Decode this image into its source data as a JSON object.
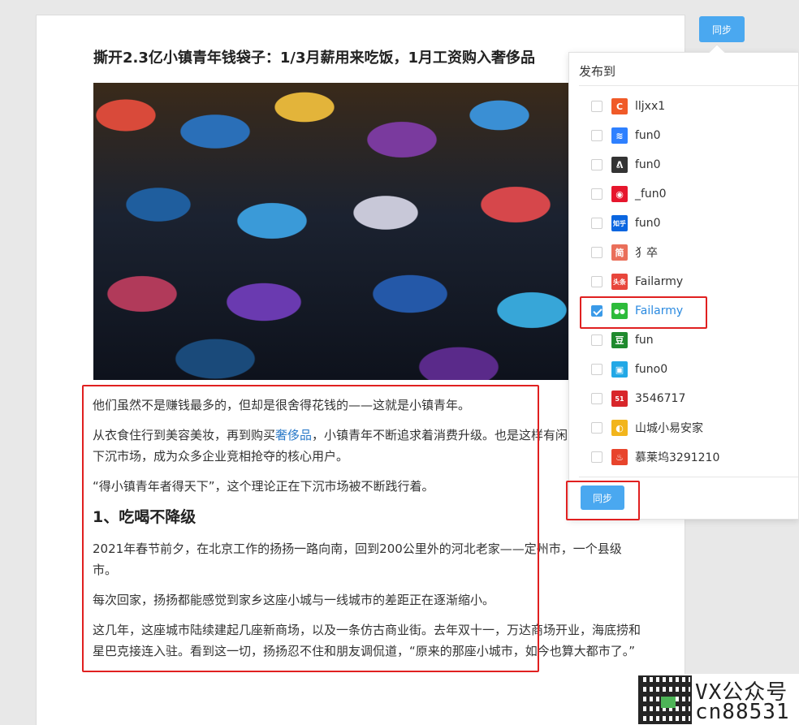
{
  "article": {
    "title": "撕开2.3亿小镇青年钱袋子：1/3月薪用来吃饭，1月工资购入奢侈品",
    "p1": "他们虽然不是赚钱最多的，但却是很舍得花钱的——这就是小镇青年。",
    "p2_a": "从衣食住行到美容美妆，再到购买",
    "p2_link": "奢侈品",
    "p2_b": "，小镇青年不断追求着消费升级。也是这样有闲的人，搅动了下沉市场，成为众多企业竞相抢夺的核心用户。",
    "p3": "“得小镇青年者得天下”，这个理论正在下沉市场被不断践行着。",
    "h1": "1、吃喝不降级",
    "p4": "2021年春节前夕，在北京工作的扬扬一路向南，回到200公里外的河北老家——定州市，一个县级市。",
    "p5": "每次回家，扬扬都能感觉到家乡这座小城与一线城市的差距正在逐渐缩小。",
    "p6": "这几年，这座城市陆续建起几座新商场，以及一条仿古商业街。去年双十一，万达商场开业，海底捞和星巴克接连入驻。看到这一切，扬扬忍不住和朋友调侃道，“原来的那座小城市，如今也算大都市了。”"
  },
  "toolbar": {
    "sync_label": "同步"
  },
  "publish_panel": {
    "title": "发布到",
    "sync_label": "同步",
    "platforms": [
      {
        "icon": "csdn-icon",
        "glyph": "C",
        "color": "#f05a28",
        "name": "lljxx1",
        "checked": false
      },
      {
        "icon": "juejin-icon",
        "glyph": "≋",
        "color": "#2e80ff",
        "name": "fun0",
        "checked": false
      },
      {
        "icon": "segmentfault-icon",
        "glyph": "ᕕ",
        "color": "#333333",
        "name": "fun0",
        "checked": false
      },
      {
        "icon": "weibo-icon",
        "glyph": "◉",
        "color": "#e6162d",
        "name": "_fun0",
        "checked": false
      },
      {
        "icon": "zhihu-icon",
        "glyph": "知乎",
        "color": "#0a66e0",
        "name": "fun0",
        "checked": false
      },
      {
        "icon": "jianshu-icon",
        "glyph": "简",
        "color": "#ea6f5a",
        "name": "犭卒",
        "checked": false
      },
      {
        "icon": "toutiao-icon",
        "glyph": "头条",
        "color": "#e8463c",
        "name": "Failarmy",
        "checked": false
      },
      {
        "icon": "wechat-icon",
        "glyph": "●●",
        "color": "#2dbb3a",
        "name": "Failarmy",
        "checked": true
      },
      {
        "icon": "douban-icon",
        "glyph": "豆",
        "color": "#1f8a2e",
        "name": "fun",
        "checked": false
      },
      {
        "icon": "bilibili-icon",
        "glyph": "▣",
        "color": "#22a8e6",
        "name": "funo0",
        "checked": false
      },
      {
        "icon": "51cto-icon",
        "glyph": "51",
        "color": "#d8262a",
        "name": "3546717",
        "checked": false
      },
      {
        "icon": "sohu-icon",
        "glyph": "◐",
        "color": "#f2b51c",
        "name": "山城小易安家",
        "checked": false
      },
      {
        "icon": "fire-icon",
        "glyph": "♨",
        "color": "#e8442c",
        "name": "慕莱坞3291210",
        "checked": false
      }
    ]
  },
  "watermark": {
    "line1": "VX公众号",
    "line2": "cn88531"
  }
}
